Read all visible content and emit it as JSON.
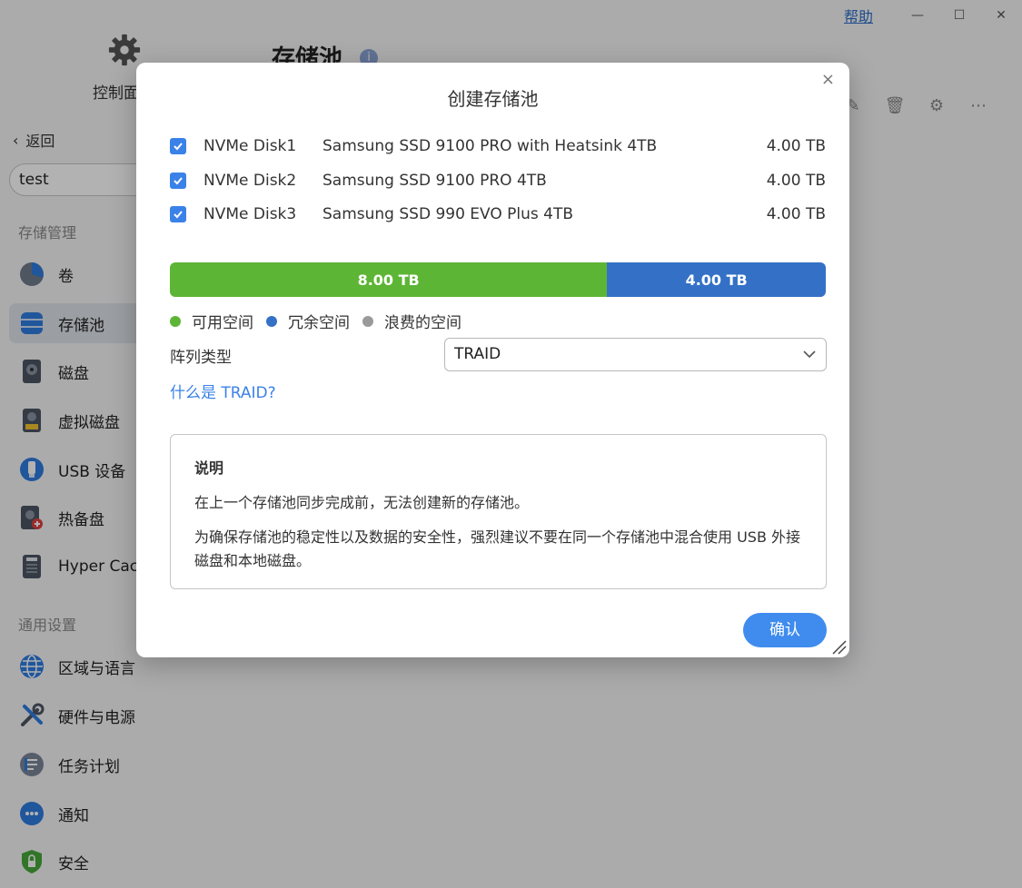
{
  "window": {
    "help": "帮助",
    "minimize": "—",
    "maximize": "☐",
    "close": "✕"
  },
  "sidebar": {
    "app_label": "控制面",
    "back": "返回",
    "search_value": "test",
    "section1": "存储管理",
    "items1": [
      {
        "label": "卷",
        "icon": "pie-chart-icon"
      },
      {
        "label": "存储池",
        "icon": "database-icon"
      },
      {
        "label": "磁盘",
        "icon": "disk-icon"
      },
      {
        "label": "虚拟磁盘",
        "icon": "virtual-disk-icon"
      },
      {
        "label": "USB 设备",
        "icon": "usb-icon"
      },
      {
        "label": "热备盘",
        "icon": "hot-spare-icon"
      },
      {
        "label": "Hyper Cach",
        "icon": "ssd-icon"
      }
    ],
    "section2": "通用设置",
    "items2": [
      {
        "label": "区域与语言",
        "icon": "globe-icon"
      },
      {
        "label": "硬件与电源",
        "icon": "tools-icon"
      },
      {
        "label": "任务计划",
        "icon": "task-icon"
      },
      {
        "label": "通知",
        "icon": "chat-icon"
      },
      {
        "label": "安全",
        "icon": "shield-icon"
      }
    ]
  },
  "main": {
    "title": "存储池",
    "info": "i"
  },
  "dialog": {
    "title": "创建存储池",
    "disks": [
      {
        "name": "NVMe Disk1",
        "model": "Samsung SSD 9100 PRO with Heatsink 4TB",
        "size": "4.00 TB",
        "checked": true
      },
      {
        "name": "NVMe Disk2",
        "model": "Samsung SSD 9100 PRO 4TB",
        "size": "4.00 TB",
        "checked": true
      },
      {
        "name": "NVMe Disk3",
        "model": "Samsung SSD 990 EVO Plus 4TB",
        "size": "4.00 TB",
        "checked": true
      }
    ],
    "capacity_bar": {
      "available": {
        "label": "8.00 TB",
        "value_tb": 8,
        "color": "#5db535"
      },
      "redundant": {
        "label": "4.00 TB",
        "value_tb": 4,
        "color": "#3471c6"
      }
    },
    "legend": [
      {
        "label": "可用空间",
        "color": "#5db535"
      },
      {
        "label": "冗余空间",
        "color": "#3471c6"
      },
      {
        "label": "浪费的空间",
        "color": "#9a9a9a"
      }
    ],
    "array_type_label": "阵列类型",
    "array_type_value": "TRAID",
    "what_is_link": "什么是 TRAID?",
    "note": {
      "title": "说明",
      "line1": "在上一个存储池同步完成前，无法创建新的存储池。",
      "line2": "为确保存储池的稳定性以及数据的安全性，强烈建议不要在同一个存储池中混合使用 USB 外接磁盘和本地磁盘。"
    },
    "confirm": "确认"
  }
}
